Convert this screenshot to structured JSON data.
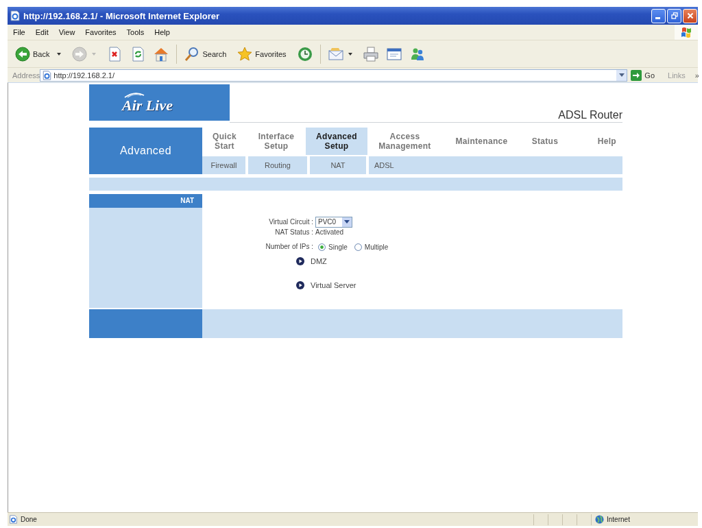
{
  "window": {
    "title": "http://192.168.2.1/ - Microsoft Internet Explorer"
  },
  "menu_bar": [
    "File",
    "Edit",
    "View",
    "Favorites",
    "Tools",
    "Help"
  ],
  "toolbar": [
    {
      "buttons": [
        {
          "kind": "back",
          "label": "Back",
          "dropdown": true,
          "disabled": false
        },
        {
          "kind": "forward",
          "dropdown": true,
          "disabled": true
        },
        {
          "kind": "stop",
          "dropdown": false,
          "disabled": false
        },
        {
          "kind": "refresh",
          "dropdown": false,
          "disabled": false
        },
        {
          "kind": "home",
          "dropdown": false,
          "disabled": false
        }
      ]
    },
    {
      "buttons": [
        {
          "kind": "search",
          "label": "Search",
          "dropdown": false,
          "disabled": false
        },
        {
          "kind": "favorites",
          "label": "Favorites",
          "dropdown": false,
          "disabled": false
        },
        {
          "kind": "history",
          "dropdown": false,
          "disabled": false
        }
      ]
    },
    {
      "buttons": [
        {
          "kind": "mail",
          "dropdown": true,
          "disabled": false
        },
        {
          "kind": "print",
          "dropdown": false,
          "disabled": false
        },
        {
          "kind": "edit",
          "dropdown": false,
          "disabled": false
        },
        {
          "kind": "messenger",
          "dropdown": false,
          "disabled": false
        }
      ]
    }
  ],
  "address_bar": {
    "label": "Address",
    "url": "http://192.168.2.1/",
    "go": "Go",
    "links": "Links",
    "more": "»"
  },
  "router": {
    "logo": "Air Live",
    "product": "ADSL Router",
    "section": "Advanced",
    "tabs": [
      {
        "label": "Quick Start",
        "selected": false
      },
      {
        "label": "Interface Setup",
        "selected": false
      },
      {
        "label": "Advanced Setup",
        "selected": true
      },
      {
        "label": "Access Management",
        "selected": false
      },
      {
        "label": "Maintenance",
        "selected": false
      },
      {
        "label": "Status",
        "selected": false
      },
      {
        "label": "Help",
        "selected": false
      }
    ],
    "sub_tabs": [
      "Firewall",
      "Routing",
      "NAT",
      "ADSL"
    ],
    "sidebar_title": "NAT",
    "form": {
      "rows": [
        {
          "kind": "select",
          "label": "Virtual Circuit :",
          "value": "PVC0"
        },
        {
          "kind": "text",
          "label": "NAT Status :",
          "value": "Activated"
        },
        {
          "kind": "radio",
          "label": "Number of IPs :",
          "options": [
            {
              "label": "Single",
              "selected": true
            },
            {
              "label": "Multiple",
              "selected": false
            }
          ]
        }
      ],
      "links": [
        "DMZ",
        "Virtual Server"
      ]
    }
  },
  "status_bar": {
    "text": "Done",
    "zone": "Internet"
  }
}
